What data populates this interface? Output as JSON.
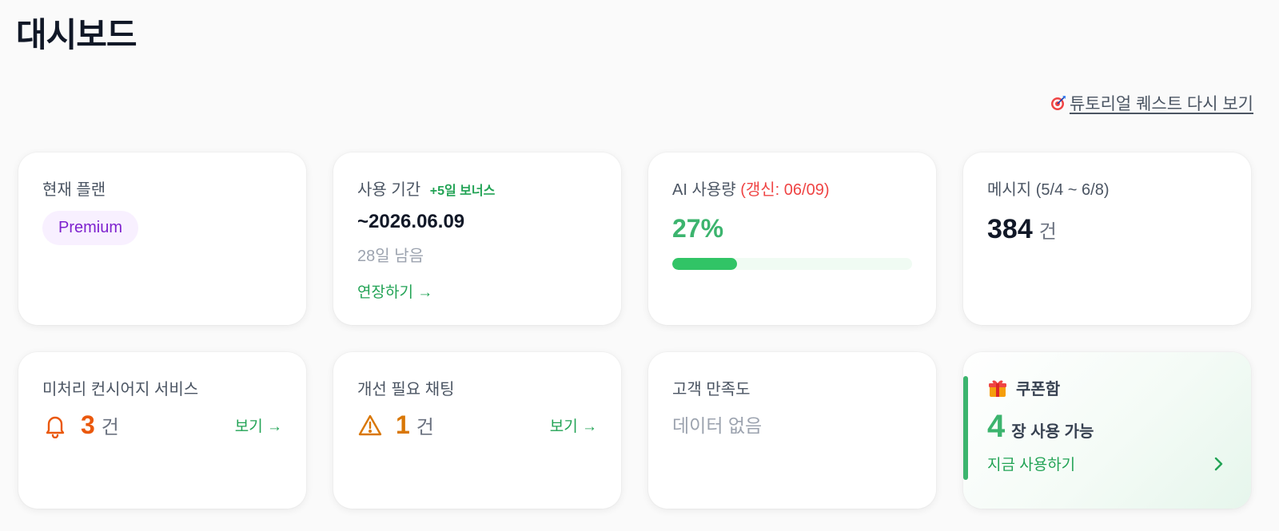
{
  "page_title": "대시보드",
  "tutorial_link": "튜토리얼 퀘스트 다시 보기",
  "cards": {
    "plan": {
      "label": "현재 플랜",
      "badge": "Premium"
    },
    "period": {
      "label": "사용 기간",
      "bonus": "+5일 보너스",
      "date": "~2026.06.09",
      "remaining": "28일 남음",
      "action": "연장하기 →"
    },
    "ai_usage": {
      "label": "AI 사용량",
      "renew": "(갱신: 06/09)",
      "percent_text": "27%",
      "progress_fraction": 0.27
    },
    "messages": {
      "label": "메시지 (5/4 ~ 6/8)",
      "count": "384",
      "unit": "건"
    },
    "concierge": {
      "label": "미처리 컨시어지 서비스",
      "count": "3",
      "unit": "건",
      "action": "보기 →"
    },
    "chat_improve": {
      "label": "개선 필요 채팅",
      "count": "1",
      "unit": "건",
      "action": "보기 →"
    },
    "satisfaction": {
      "label": "고객 만족도",
      "empty": "데이터 없음"
    },
    "coupon": {
      "title": "쿠폰함",
      "count": "4",
      "count_text": "장 사용 가능",
      "action": "지금 사용하기"
    }
  },
  "colors": {
    "accent_green": "#3cb46e",
    "badge_purple": "#7e22ce",
    "warning_orange": "#ea580c",
    "warning_amber": "#d97706",
    "renew_red": "#ef4444"
  },
  "icons": {
    "tutorial": "target-icon",
    "concierge": "bell-icon",
    "chat_improve": "warning-icon",
    "coupon": "gift-icon",
    "coupon_action": "chevron-right-icon"
  }
}
